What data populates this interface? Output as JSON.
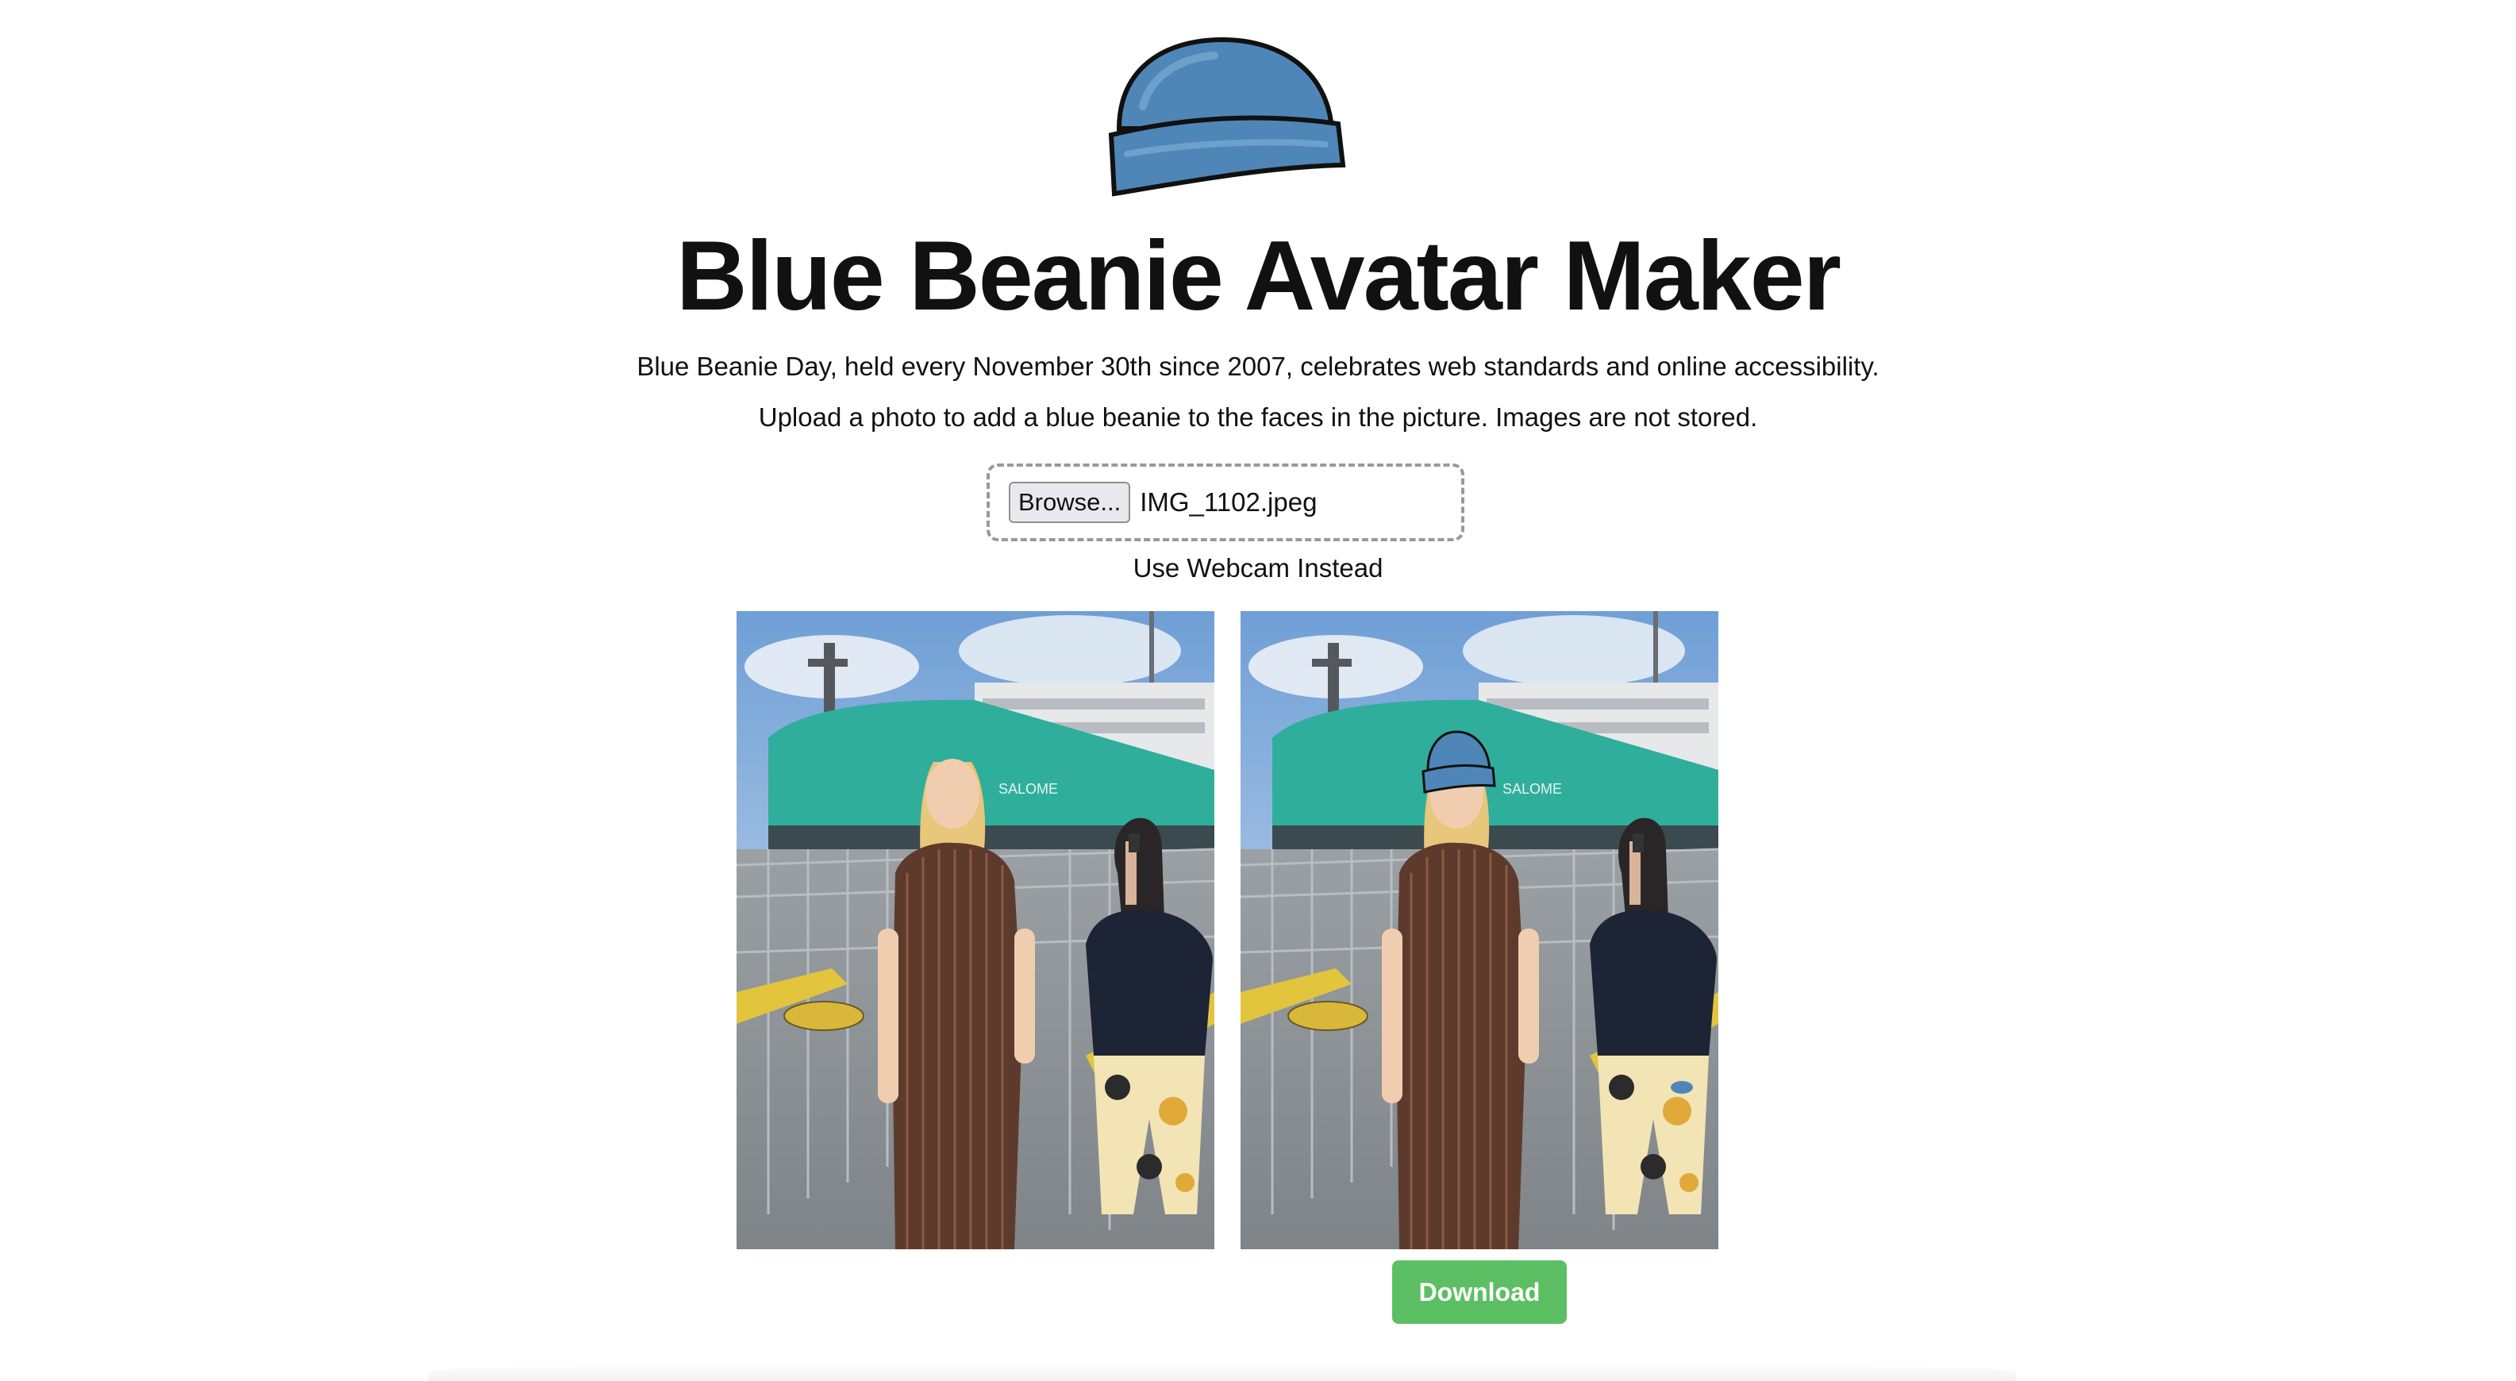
{
  "header": {
    "logo_icon": "blue-beanie-icon",
    "title": "Blue Beanie Avatar Maker",
    "description_1": "Blue Beanie Day, held every November 30th since 2007, celebrates web standards and online accessibility.",
    "description_2": "Upload a photo to add a blue beanie to the faces in the picture. Images are not stored."
  },
  "upload": {
    "browse_label": "Browse...",
    "file_name": "IMG_1102.jpeg",
    "webcam_label": "Use Webcam Instead"
  },
  "photos": {
    "original_icon": "photo-original",
    "result_icon": "photo-with-beanie"
  },
  "actions": {
    "download_label": "Download"
  },
  "colors": {
    "beanie": "#4f86b8",
    "beanie_outline": "#111111",
    "download_button": "#5cbf63",
    "ship_hull": "#2fae9c"
  }
}
